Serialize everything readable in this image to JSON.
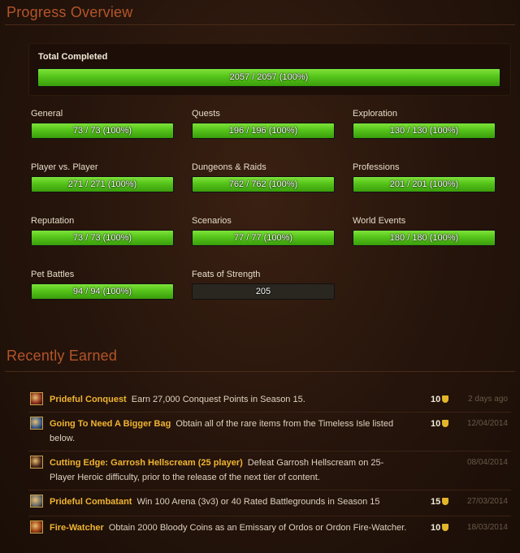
{
  "progress": {
    "title": "Progress Overview",
    "total": {
      "label": "Total Completed",
      "text": "2057 / 2057 (100%)",
      "fraction": 1.0
    },
    "categories": [
      {
        "label": "General",
        "text": "73 / 73 (100%)",
        "fraction": 1.0
      },
      {
        "label": "Quests",
        "text": "196 / 196 (100%)",
        "fraction": 1.0
      },
      {
        "label": "Exploration",
        "text": "130 / 130 (100%)",
        "fraction": 1.0
      },
      {
        "label": "Player vs. Player",
        "text": "271 / 271 (100%)",
        "fraction": 1.0
      },
      {
        "label": "Dungeons & Raids",
        "text": "762 / 762 (100%)",
        "fraction": 1.0
      },
      {
        "label": "Professions",
        "text": "201 / 201 (100%)",
        "fraction": 1.0
      },
      {
        "label": "Reputation",
        "text": "73 / 73 (100%)",
        "fraction": 1.0
      },
      {
        "label": "Scenarios",
        "text": "77 / 77 (100%)",
        "fraction": 1.0
      },
      {
        "label": "World Events",
        "text": "180 / 180 (100%)",
        "fraction": 1.0
      },
      {
        "label": "Pet Battles",
        "text": "94 / 94 (100%)",
        "fraction": 1.0
      },
      {
        "label": "Feats of Strength",
        "text": "205",
        "fraction": 0.0
      }
    ]
  },
  "recent": {
    "title": "Recently Earned",
    "items": [
      {
        "name": "Prideful Conquest",
        "desc": "Earn 27,000 Conquest Points in Season 15.",
        "points": "10",
        "date": "2 days ago",
        "icon": "conquest-icon",
        "icon_color": "#8a2a1a"
      },
      {
        "name": "Going To Need A Bigger Bag",
        "desc": "Obtain all of the rare items from the Timeless Isle listed below.",
        "points": "10",
        "date": "12/04/2014",
        "icon": "bag-icon",
        "icon_color": "#3a5a8a"
      },
      {
        "name": "Cutting Edge: Garrosh Hellscream (25 player)",
        "desc": "Defeat Garrosh Hellscream on 25-Player Heroic difficulty, prior to the release of the next tier of content.",
        "points": "",
        "date": "08/04/2014",
        "icon": "garrosh-icon",
        "icon_color": "#4a2418"
      },
      {
        "name": "Prideful Combatant",
        "desc": "Win 100 Arena (3v3) or 40 Rated Battlegrounds in Season 15",
        "points": "15",
        "date": "27/03/2014",
        "icon": "combatant-icon",
        "icon_color": "#6a6a6a"
      },
      {
        "name": "Fire-Watcher",
        "desc": "Obtain 2000 Bloody Coins as an Emissary of Ordos or Ordon Fire-Watcher.",
        "points": "10",
        "date": "18/03/2014",
        "icon": "fire-icon",
        "icon_color": "#9a3a10"
      }
    ]
  },
  "colors": {
    "accent": "#b4552a",
    "bar_green": "#55c41a",
    "name_gold": "#f0b431"
  }
}
